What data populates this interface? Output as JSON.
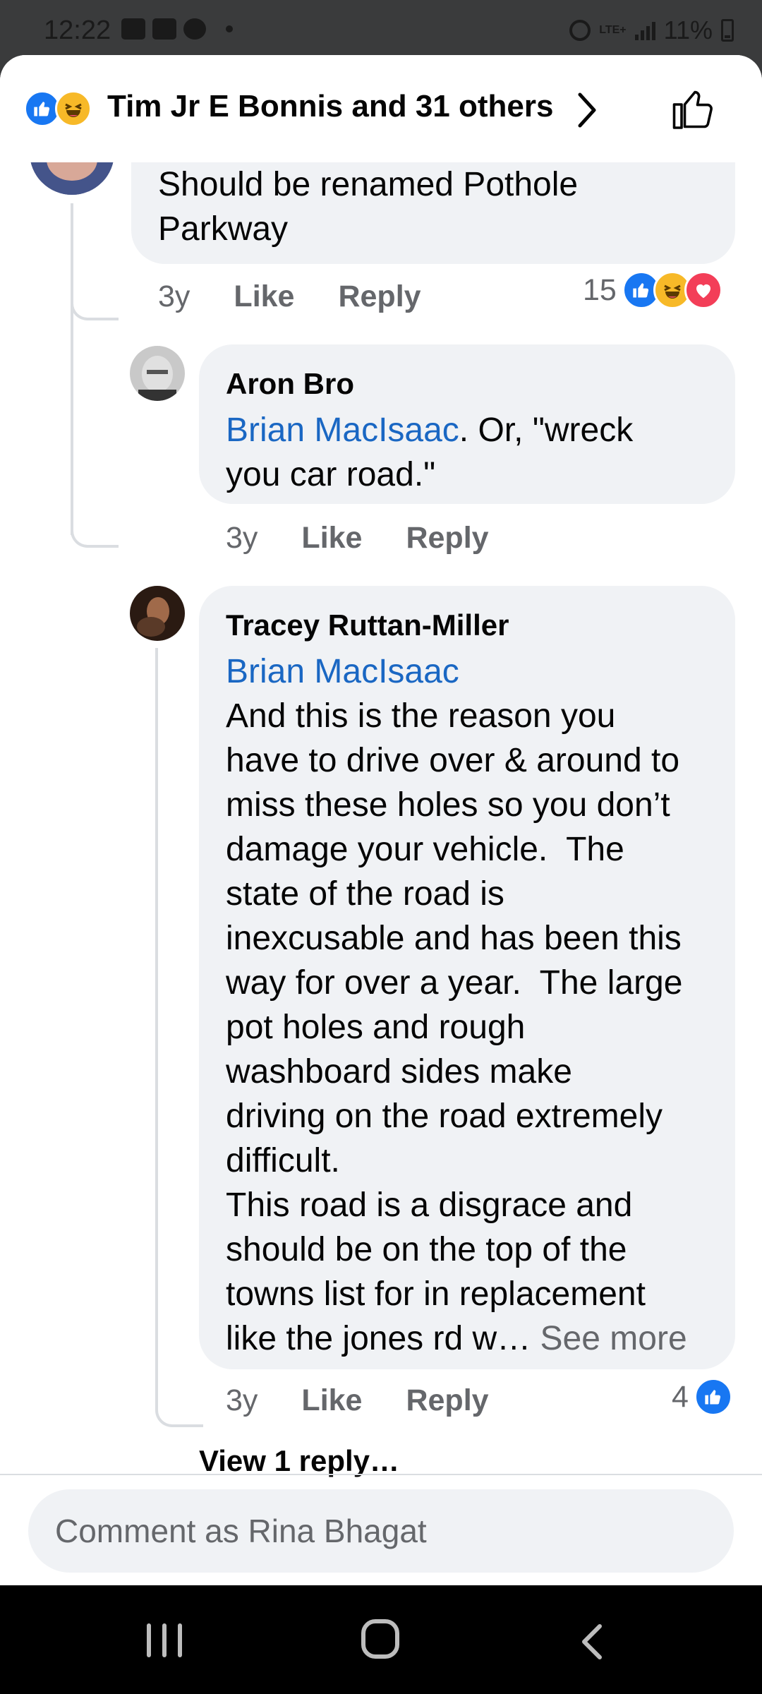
{
  "status_bar": {
    "time": "12:22",
    "network": "LTE+",
    "battery": "11%"
  },
  "header": {
    "reactions": [
      "like",
      "haha"
    ],
    "title": "Tim Jr E Bonnis and 31 others"
  },
  "comments": [
    {
      "text_lines": [
        "Should be renamed Pothole",
        "Parkway"
      ],
      "time": "3y",
      "like_label": "Like",
      "reply_label": "Reply",
      "reaction_count": "15",
      "reactions": [
        "like",
        "haha",
        "love"
      ]
    },
    {
      "author": "Aron Bro",
      "mention": "Brian MacIsaac",
      "text_line1_rest": ". Or, \"wreck",
      "text_line2": "you car road.\"",
      "time": "3y",
      "like_label": "Like",
      "reply_label": "Reply"
    },
    {
      "author": "Tracey Ruttan-Miller",
      "mention": "Brian MacIsaac",
      "text_lines": [
        "And this is the reason you",
        "have to drive over & around to",
        "miss these holes so you don’t",
        "damage your vehicle.  The",
        "state of the road is",
        "inexcusable and has been this",
        "way for over a year.  The large",
        "pot holes and rough",
        "washboard sides make",
        "driving on the road extremely",
        "difficult.",
        "This road is a disgrace and",
        "should be on the top of the",
        "towns list for in replacement"
      ],
      "last_line": "like the jones rd w…",
      "see_more": "See more",
      "time": "3y",
      "like_label": "Like",
      "reply_label": "Reply",
      "reaction_count": "4",
      "reactions": [
        "like"
      ]
    }
  ],
  "view_replies": "View 1 reply…",
  "comment_input": {
    "placeholder": "Comment as Rina Bhagat"
  },
  "colors": {
    "accent": "#1877f2",
    "mention": "#1a67c3",
    "bubble": "#f0f2f5",
    "secondary_text": "#65676b"
  }
}
